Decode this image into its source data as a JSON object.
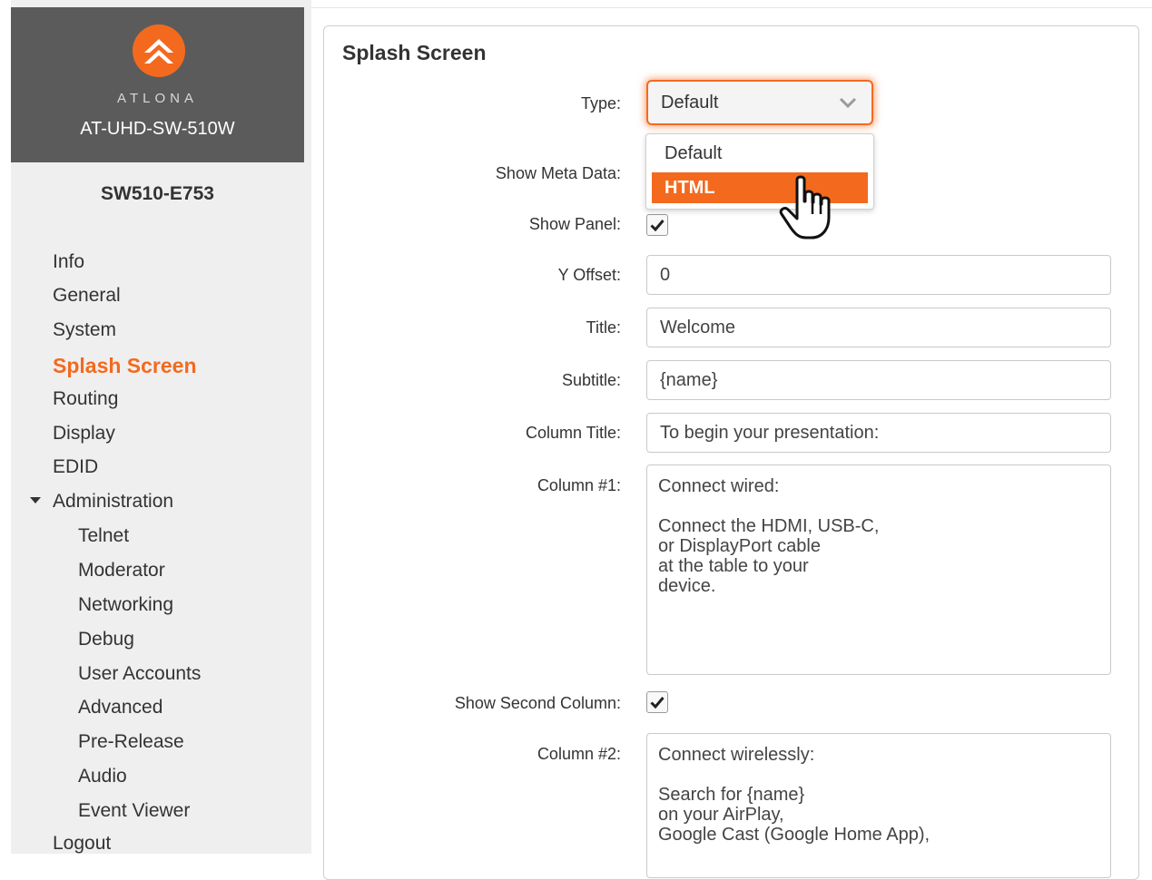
{
  "sidebar": {
    "brand": {
      "wordmark": "ATLONA",
      "model": "AT-UHD-SW-510W"
    },
    "device_name": "SW510-E753",
    "nav": [
      {
        "label": "Info"
      },
      {
        "label": "General"
      },
      {
        "label": "System"
      },
      {
        "label": "Splash Screen",
        "active": true
      },
      {
        "label": "Routing"
      },
      {
        "label": "Display"
      },
      {
        "label": "EDID"
      },
      {
        "label": "Administration",
        "expanded": true
      }
    ],
    "admin_children": [
      {
        "label": "Telnet"
      },
      {
        "label": "Moderator"
      },
      {
        "label": "Networking"
      },
      {
        "label": "Debug"
      },
      {
        "label": "User Accounts"
      },
      {
        "label": "Advanced"
      },
      {
        "label": "Pre-Release"
      },
      {
        "label": "Audio"
      },
      {
        "label": "Event Viewer"
      }
    ],
    "logout": "Logout"
  },
  "panel": {
    "title": "Splash Screen",
    "type": {
      "label": "Type:",
      "value": "Default",
      "options": [
        "Default",
        "HTML"
      ],
      "highlighted_option": "HTML"
    },
    "show_meta_data": {
      "label": "Show Meta Data:"
    },
    "show_panel": {
      "label": "Show Panel:",
      "checked": true
    },
    "y_offset": {
      "label": "Y Offset:",
      "value": "0"
    },
    "title_field": {
      "label": "Title:",
      "value": "Welcome"
    },
    "subtitle": {
      "label": "Subtitle:",
      "value": "{name}"
    },
    "column_title": {
      "label": "Column Title:",
      "value": "To begin your presentation:"
    },
    "column1": {
      "label": "Column #1:",
      "lines": [
        "Connect wired:",
        "",
        "Connect the HDMI, USB-C,",
        "or DisplayPort cable",
        "at the table to your",
        "device."
      ]
    },
    "show_second_column": {
      "label": "Show Second Column:",
      "checked": true
    },
    "column2": {
      "label": "Column #2:",
      "lines": [
        "Connect wirelessly:",
        "",
        "Search for {name}",
        "on your AirPlay,",
        "Google Cast (Google Home App),"
      ]
    }
  },
  "colors": {
    "accent": "#f36a1f",
    "sidebar_bg": "#efefef",
    "brand_bg": "#5b5b5b"
  },
  "icons": {
    "select_chevron": "chevron-down-icon",
    "checkbox": "checkmark-icon",
    "pointer": "hand-pointer-icon",
    "submenu": "caret-down-icon"
  }
}
